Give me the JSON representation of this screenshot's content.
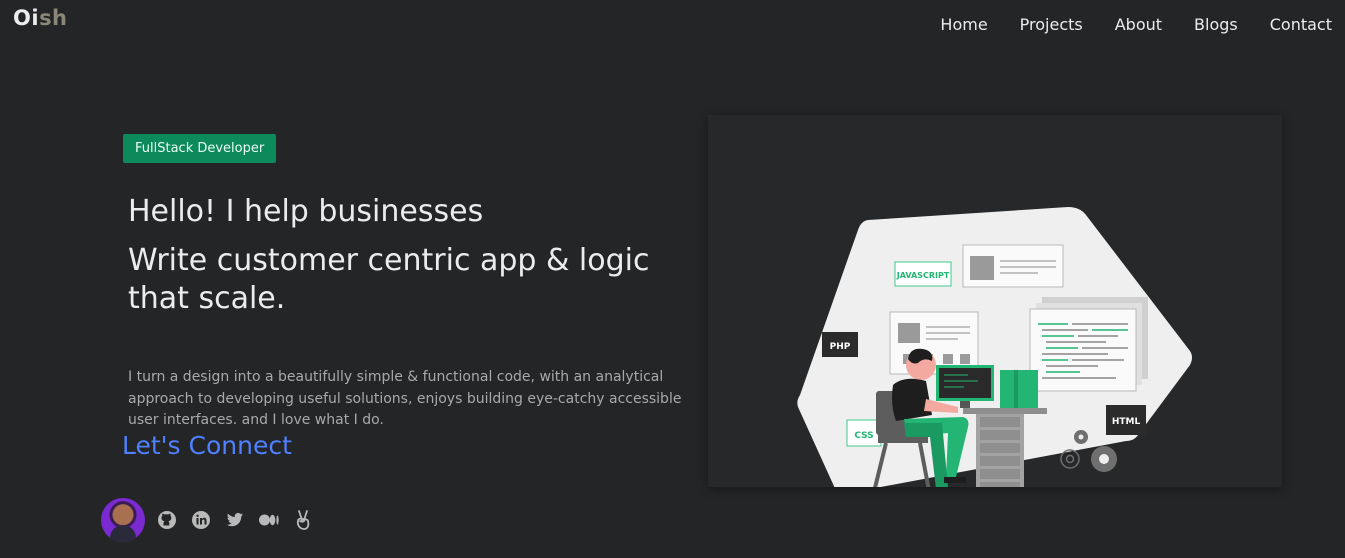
{
  "brand": {
    "part1": "Oi",
    "part2": "sh"
  },
  "nav": {
    "items": [
      "Home",
      "Projects",
      "About",
      "Blogs",
      "Contact"
    ]
  },
  "hero": {
    "badge": "FullStack Developer",
    "headline1": "Hello! I help businesses",
    "headline2": "Write customer centric app & logic that scale.",
    "description": "I turn a design into a beautifully simple & functional code, with an analytical approach to developing useful solutions, enjoys building eye-catchy accessible user interfaces. and I love what I do.",
    "cta": "Let's Connect"
  },
  "illustration": {
    "labels": {
      "javascript": "JAVASCRIPT",
      "php": "PHP",
      "css": "CSS",
      "html": "HTML"
    }
  },
  "social": {
    "icons": [
      "avatar",
      "github-icon",
      "linkedin-icon",
      "twitter-icon",
      "medium-icon",
      "angellist-icon"
    ]
  },
  "colors": {
    "background": "#232526",
    "badge": "#0d8a5c",
    "link": "#4f80ff",
    "accent_green": "#22b573"
  }
}
